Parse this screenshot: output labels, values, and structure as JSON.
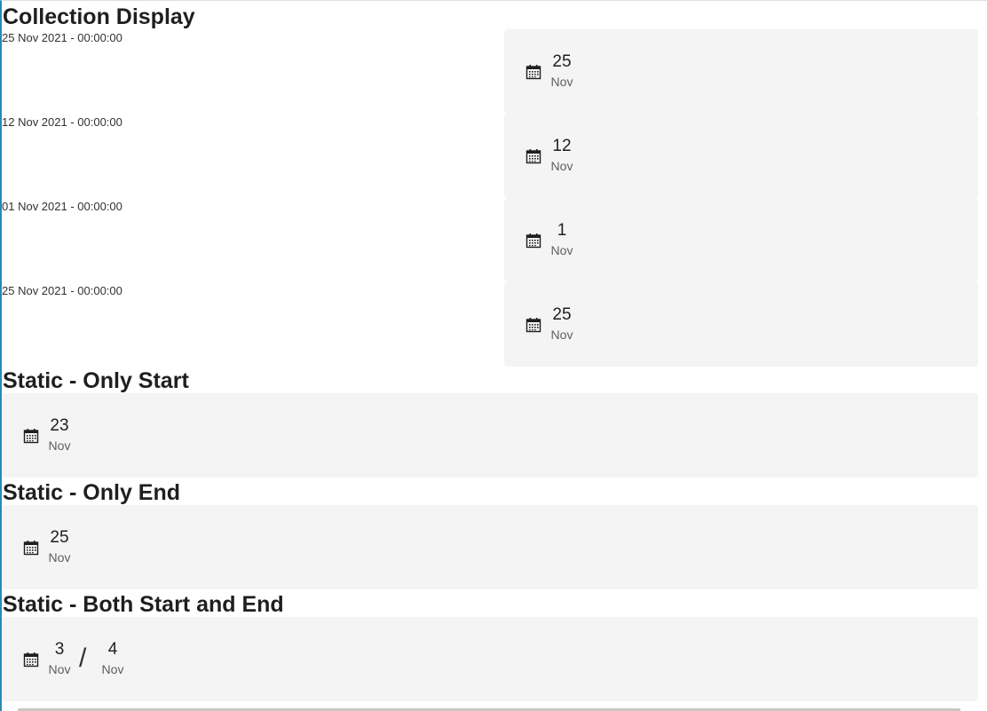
{
  "collection": {
    "title": "Collection Display",
    "rows": [
      {
        "label": "25 Nov 2021 - 00:00:00",
        "day": "25",
        "month": "Nov"
      },
      {
        "label": "12 Nov 2021 - 00:00:00",
        "day": "12",
        "month": "Nov"
      },
      {
        "label": "01 Nov 2021 - 00:00:00",
        "day": "1",
        "month": "Nov"
      },
      {
        "label": "25 Nov 2021 - 00:00:00",
        "day": "25",
        "month": "Nov"
      }
    ]
  },
  "only_start": {
    "title": "Static - Only Start",
    "day": "23",
    "month": "Nov"
  },
  "only_end": {
    "title": "Static - Only End",
    "day": "25",
    "month": "Nov"
  },
  "both": {
    "title": "Static - Both Start and End",
    "start_day": "3",
    "start_month": "Nov",
    "separator": "/",
    "end_day": "4",
    "end_month": "Nov"
  },
  "icons": {
    "calendar": "calendar-icon"
  }
}
